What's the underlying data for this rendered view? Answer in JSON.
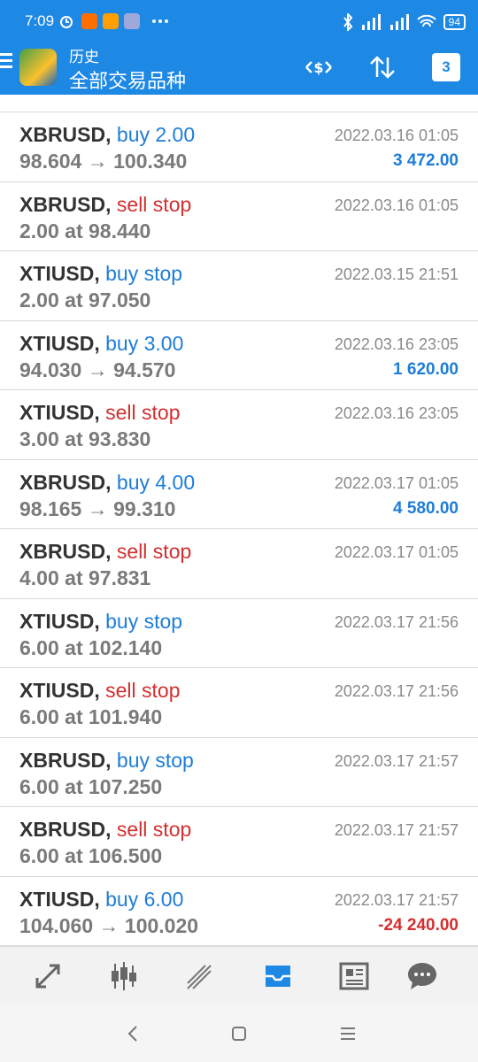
{
  "status": {
    "time": "7:09",
    "battery": "94"
  },
  "header": {
    "subtitle": "历史",
    "title": "全部交易品种",
    "calendar_day": "3"
  },
  "trades": [
    {
      "symbol": "XBRUSD,",
      "action": "buy 2.00",
      "side": "buy",
      "detail": "98.604 → 100.340",
      "date": "2022.03.16 01:05",
      "profit": "3 472.00",
      "profit_sign": "pos"
    },
    {
      "symbol": "XBRUSD,",
      "action": "sell stop",
      "side": "sell",
      "detail": "2.00 at 98.440",
      "date": "2022.03.16 01:05",
      "profit": "",
      "profit_sign": ""
    },
    {
      "symbol": "XTIUSD,",
      "action": "buy stop",
      "side": "buy",
      "detail": "2.00 at 97.050",
      "date": "2022.03.15 21:51",
      "profit": "",
      "profit_sign": ""
    },
    {
      "symbol": "XTIUSD,",
      "action": "buy 3.00",
      "side": "buy",
      "detail": "94.030 → 94.570",
      "date": "2022.03.16 23:05",
      "profit": "1 620.00",
      "profit_sign": "pos"
    },
    {
      "symbol": "XTIUSD,",
      "action": "sell stop",
      "side": "sell",
      "detail": "3.00 at 93.830",
      "date": "2022.03.16 23:05",
      "profit": "",
      "profit_sign": ""
    },
    {
      "symbol": "XBRUSD,",
      "action": "buy 4.00",
      "side": "buy",
      "detail": "98.165 → 99.310",
      "date": "2022.03.17 01:05",
      "profit": "4 580.00",
      "profit_sign": "pos"
    },
    {
      "symbol": "XBRUSD,",
      "action": "sell stop",
      "side": "sell",
      "detail": "4.00 at 97.831",
      "date": "2022.03.17 01:05",
      "profit": "",
      "profit_sign": ""
    },
    {
      "symbol": "XTIUSD,",
      "action": "buy stop",
      "side": "buy",
      "detail": "6.00 at 102.140",
      "date": "2022.03.17 21:56",
      "profit": "",
      "profit_sign": ""
    },
    {
      "symbol": "XTIUSD,",
      "action": "sell stop",
      "side": "sell",
      "detail": "6.00 at 101.940",
      "date": "2022.03.17 21:56",
      "profit": "",
      "profit_sign": ""
    },
    {
      "symbol": "XBRUSD,",
      "action": "buy stop",
      "side": "buy",
      "detail": "6.00 at 107.250",
      "date": "2022.03.17 21:57",
      "profit": "",
      "profit_sign": ""
    },
    {
      "symbol": "XBRUSD,",
      "action": "sell stop",
      "side": "sell",
      "detail": "6.00 at 106.500",
      "date": "2022.03.17 21:57",
      "profit": "",
      "profit_sign": ""
    },
    {
      "symbol": "XTIUSD,",
      "action": "buy 6.00",
      "side": "buy",
      "detail": "104.060 → 100.020",
      "date": "2022.03.17 21:57",
      "profit": "-24 240.00",
      "profit_sign": "neg"
    }
  ],
  "colors": {
    "header_bg": "#1e88e5",
    "buy": "#1e7dd7",
    "sell": "#d32f2f"
  },
  "bottom_nav": [
    "quotes-icon",
    "chart-icon",
    "trade-icon",
    "history-icon",
    "news-icon",
    "chat-icon"
  ],
  "system_nav": [
    "back-icon",
    "home-icon",
    "menu-icon"
  ]
}
